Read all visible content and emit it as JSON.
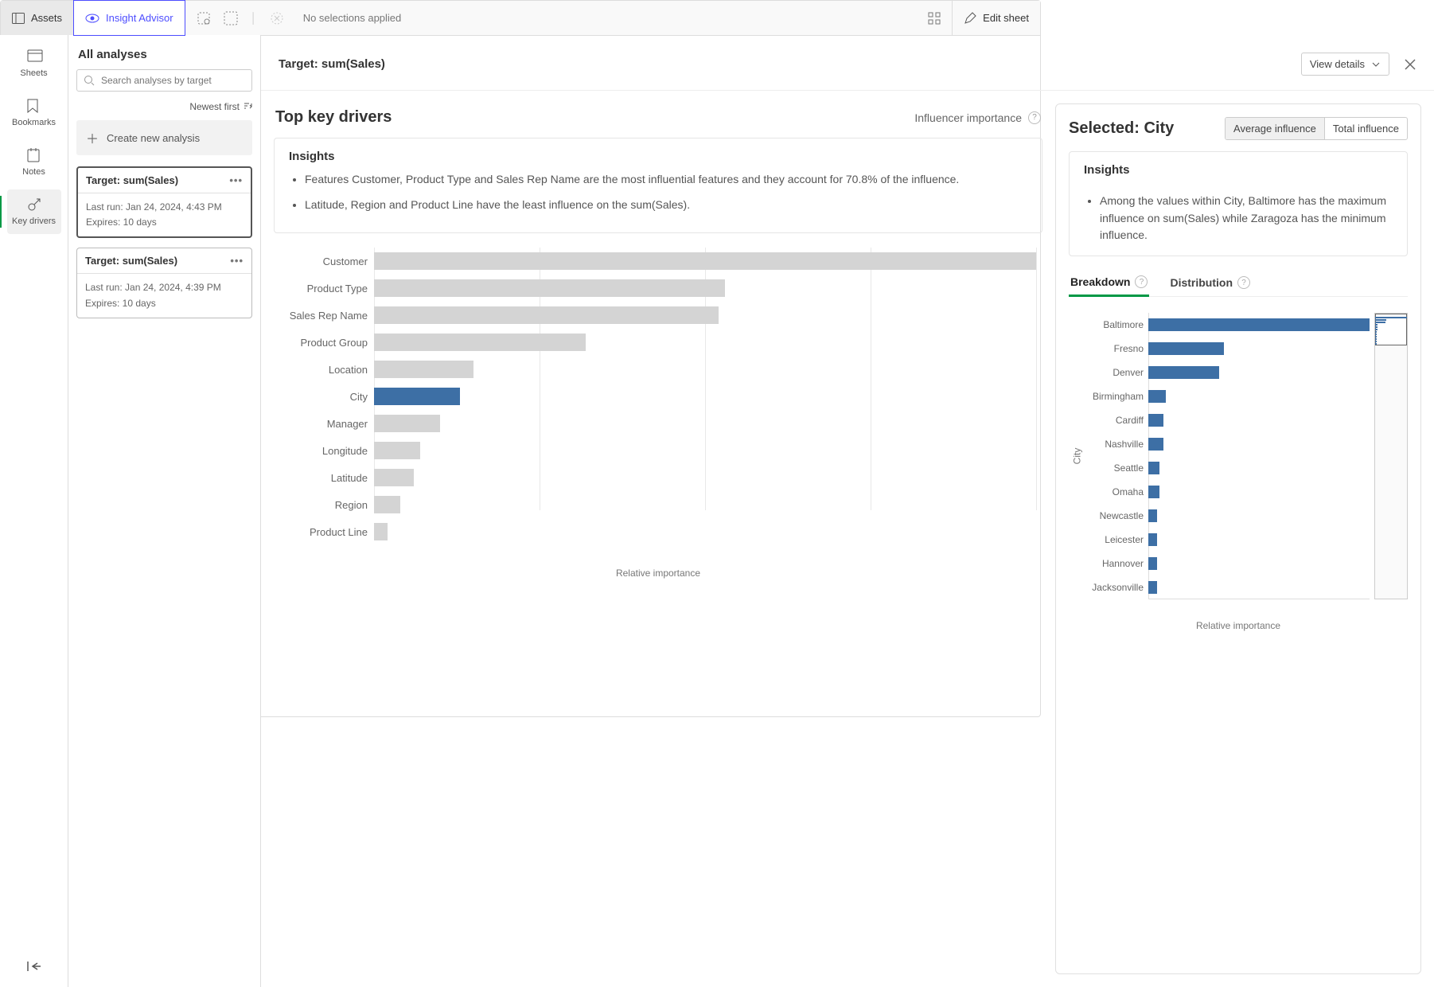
{
  "topbar": {
    "assets_label": "Assets",
    "insight_label": "Insight Advisor",
    "no_selections": "No selections applied",
    "edit_sheet": "Edit sheet"
  },
  "rail": {
    "sheets": "Sheets",
    "bookmarks": "Bookmarks",
    "notes": "Notes",
    "key_drivers": "Key drivers"
  },
  "panel": {
    "title": "All analyses",
    "search_placeholder": "Search analyses by target",
    "sort_label": "Newest first",
    "create_label": "Create new analysis",
    "cards": [
      {
        "title": "Target: sum(Sales)",
        "last_run": "Last run: Jan 24, 2024, 4:43 PM",
        "expires": "Expires: 10 days"
      },
      {
        "title": "Target: sum(Sales)",
        "last_run": "Last run: Jan 24, 2024, 4:39 PM",
        "expires": "Expires: 10 days"
      }
    ]
  },
  "main": {
    "target_title": "Target: sum(Sales)",
    "view_details": "View details",
    "kd_title": "Top key drivers",
    "influencer_label": "Influencer importance",
    "insights_title": "Insights",
    "insights": [
      "Features Customer, Product Type and Sales Rep Name are the most influential features and they account for 70.8% of the influence.",
      "Latitude, Region and Product Line have the least influence on the sum(Sales)."
    ],
    "kd_xlabel": "Relative importance",
    "selected_prefix": "Selected: ",
    "selected_value": "City",
    "seg_avg": "Average influence",
    "seg_total": "Total influence",
    "sel_insights_title": "Insights",
    "sel_insights": [
      "Among the values within City, Baltimore has the maximum influence on sum(Sales) while Zaragoza has the minimum influence."
    ],
    "tab_breakdown": "Breakdown",
    "tab_distribution": "Distribution",
    "city_axis": "City",
    "city_xlabel": "Relative importance"
  },
  "chart_data": [
    {
      "id": "key_drivers",
      "type": "bar",
      "orientation": "horizontal",
      "xlabel": "Relative importance",
      "categories": [
        "Customer",
        "Product Type",
        "Sales Rep Name",
        "Product Group",
        "Location",
        "City",
        "Manager",
        "Longitude",
        "Latitude",
        "Region",
        "Product Line"
      ],
      "values": [
        100,
        53,
        52,
        32,
        15,
        13,
        10,
        7,
        6,
        4,
        2
      ],
      "highlight_index": 5,
      "xlim": [
        0,
        100
      ]
    },
    {
      "id": "city_breakdown",
      "type": "bar",
      "orientation": "horizontal",
      "xlabel": "Relative importance",
      "ylabel": "City",
      "categories": [
        "Baltimore",
        "Fresno",
        "Denver",
        "Birmingham",
        "Cardiff",
        "Nashville",
        "Seattle",
        "Omaha",
        "Newcastle",
        "Leicester",
        "Hannover",
        "Jacksonville"
      ],
      "values": [
        100,
        34,
        32,
        8,
        7,
        7,
        5,
        5,
        4,
        4,
        4,
        4
      ],
      "xlim": [
        0,
        100
      ]
    }
  ]
}
